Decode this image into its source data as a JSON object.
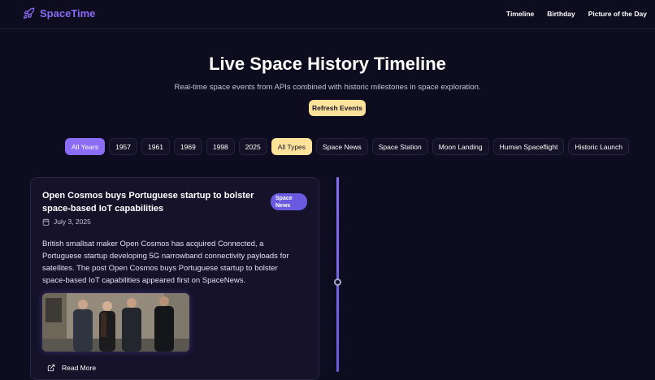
{
  "brand": {
    "name": "SpaceTime",
    "icon": "rocket-icon",
    "color": "#8b6cf7"
  },
  "nav": {
    "links": [
      "Timeline",
      "Birthday",
      "Picture of the Day"
    ]
  },
  "hero": {
    "title": "Live Space History Timeline",
    "subtitle": "Real-time space events from APIs combined with historic milestones in space exploration.",
    "refresh_label": "Refresh Events"
  },
  "filters": {
    "years": [
      "All Years",
      "1957",
      "1961",
      "1969",
      "1998",
      "2025"
    ],
    "selected_year": "All Years",
    "types": [
      "All Types",
      "Space News",
      "Space Station",
      "Moon Landing",
      "Human Spaceflight",
      "Historic Launch"
    ],
    "selected_type": "All Types"
  },
  "event": {
    "title": "Open Cosmos buys Portuguese startup to bolster space-based IoT capabilities",
    "badge": "Space News",
    "date": "July 3, 2025",
    "body": "British smallsat maker Open Cosmos has acquired Connected, a Portuguese startup developing 5G narrowband connectivity payloads for satellites. The post Open Cosmos buys Portuguese startup to bolster space-based IoT capabilities appeared first on SpaceNews.",
    "read_more": "Read More"
  },
  "colors": {
    "background": "#0e0c1f",
    "accent_purple": "#8b6cf7",
    "accent_yellow": "#fde29a",
    "badge": "#6a5ae0"
  }
}
